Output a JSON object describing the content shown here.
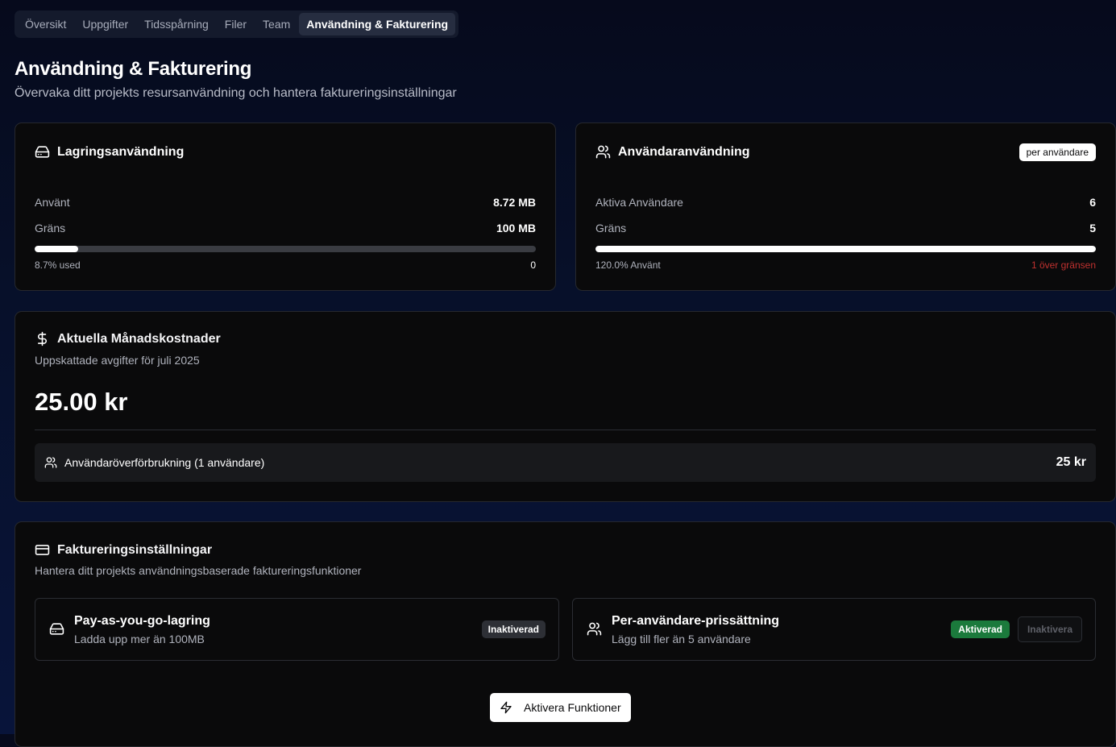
{
  "tabs": [
    {
      "label": "Översikt"
    },
    {
      "label": "Uppgifter"
    },
    {
      "label": "Tidsspårning"
    },
    {
      "label": "Filer"
    },
    {
      "label": "Team"
    },
    {
      "label": "Användning & Fakturering",
      "active": true
    }
  ],
  "header": {
    "title": "Användning & Fakturering",
    "subtitle": "Övervaka ditt projekts resursanvändning och hantera faktureringsinställningar"
  },
  "storage": {
    "icon": "hard-drive-icon",
    "title": "Lagringsanvändning",
    "used_label": "Använt",
    "used_value": "8.72 MB",
    "limit_label": "Gräns",
    "limit_value": "100 MB",
    "progress_percent": 8.7,
    "footer_left": "8.7% used",
    "footer_right": "0"
  },
  "users": {
    "icon": "users-icon",
    "title": "Användaranvändning",
    "badge": "per användare",
    "active_label": "Aktiva Användare",
    "active_value": "6",
    "limit_label": "Gräns",
    "limit_value": "5",
    "progress_percent": 100,
    "footer_left": "120.0% Använt",
    "footer_right": "1 över gränsen"
  },
  "costs": {
    "icon": "dollar-icon",
    "title": "Aktuella Månadskostnader",
    "subtitle": "Uppskattade avgifter för juli 2025",
    "total": "25.00 kr",
    "items": [
      {
        "icon": "users-icon",
        "label": "Användaröverförbrukning (1 användare)",
        "amount": "25 kr"
      }
    ]
  },
  "billing": {
    "icon": "credit-card-icon",
    "title": "Faktureringsinställningar",
    "subtitle": "Hantera ditt projekts användningsbaserade faktureringsfunktioner",
    "features": [
      {
        "icon": "hard-drive-icon",
        "title": "Pay-as-you-go-lagring",
        "desc": "Ladda upp mer än 100MB",
        "status": "Inaktiverad"
      },
      {
        "icon": "users-icon",
        "title": "Per-användare-prissättning",
        "desc": "Lägg till fler än 5 användare",
        "status": "Aktiverad",
        "action": "Inaktivera"
      }
    ],
    "activate_button": "Aktivera Funktioner"
  },
  "colors": {
    "accent_green": "#1b7a3c",
    "danger_red": "#c0312f",
    "background": "#07102a",
    "card": "#0a0a0b"
  }
}
